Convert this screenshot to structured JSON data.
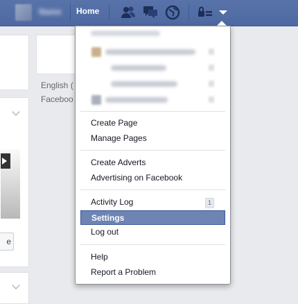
{
  "topbar": {
    "home_label": "Home",
    "icons": [
      "friend-requests-icon",
      "messages-icon",
      "notifications-globe-icon",
      "privacy-shortcuts-icon",
      "account-menu-caret-icon"
    ]
  },
  "background": {
    "language_text": "English (",
    "facebook_text": "Faceboo",
    "button_fragment": "e"
  },
  "menu": {
    "group_pages": [
      "Create Page",
      "Manage Pages"
    ],
    "group_adverts": [
      "Create Adverts",
      "Advertising on Facebook"
    ],
    "activity_log": "Activity Log",
    "activity_log_count": "1",
    "settings": "Settings",
    "logout": "Log out",
    "group_help": [
      "Help",
      "Report a Problem"
    ]
  },
  "colors": {
    "topbar": "#4e69a2",
    "selected_item": "#6d84b4"
  }
}
